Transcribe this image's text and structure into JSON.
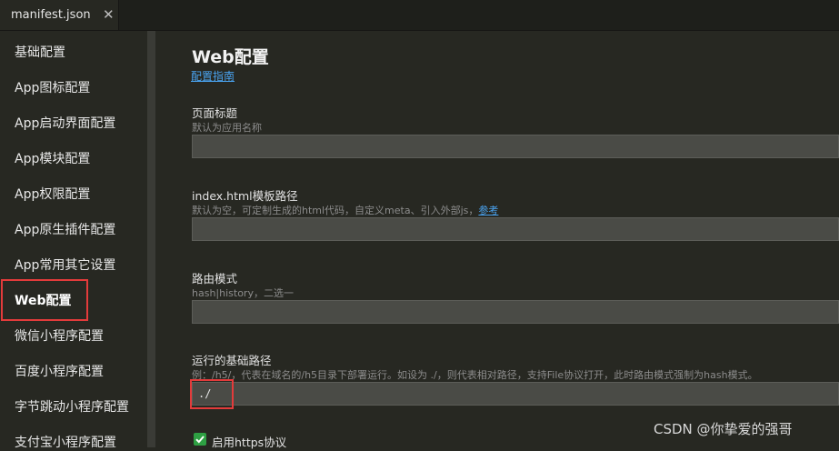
{
  "tab": {
    "label": "manifest.json",
    "close_glyph": "✕"
  },
  "sidebar": {
    "items": [
      {
        "label": "基础配置"
      },
      {
        "label": "App图标配置"
      },
      {
        "label": "App启动界面配置"
      },
      {
        "label": "App模块配置"
      },
      {
        "label": "App权限配置"
      },
      {
        "label": "App原生插件配置"
      },
      {
        "label": "App常用其它设置"
      },
      {
        "label": "Web配置"
      },
      {
        "label": "微信小程序配置"
      },
      {
        "label": "百度小程序配置"
      },
      {
        "label": "字节跳动小程序配置"
      },
      {
        "label": "支付宝小程序配置"
      }
    ],
    "active_index": 7
  },
  "main": {
    "title": "Web配置",
    "guide_link": "配置指南",
    "fields": [
      {
        "label": "页面标题",
        "hint": "默认为应用名称",
        "value": ""
      },
      {
        "label": "index.html模板路径",
        "hint": "默认为空，可定制生成的html代码，自定义meta、引入外部js，",
        "hint_link": "参考",
        "value": ""
      },
      {
        "label": "路由模式",
        "hint": "hash|history，二选一",
        "value": ""
      },
      {
        "label": "运行的基础路径",
        "hint": "例：/h5/，代表在域名的/h5目录下部署运行。如设为 ./，则代表相对路径，支持File协议打开，此时路由模式强制为hash模式。",
        "value": "./"
      }
    ],
    "https_checkbox": {
      "label": "启用https协议",
      "checked": true
    }
  },
  "watermark": "CSDN @你挚爱的强哥",
  "colors": {
    "highlight": "#e33b3b",
    "link": "#4aa3f0",
    "checkbox": "#2ea043",
    "background": "#272822"
  },
  "icons": {
    "tab_close": "close-icon",
    "checkbox": "check-icon"
  }
}
